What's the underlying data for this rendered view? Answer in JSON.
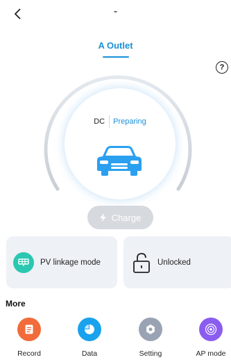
{
  "header": {
    "title": "-"
  },
  "tab": {
    "label": "A Outlet"
  },
  "status": {
    "type": "DC",
    "state": "Preparing"
  },
  "charge": {
    "label": "Charge"
  },
  "cards": {
    "pv_label": "PV linkage mode",
    "lock_label": "Unlocked"
  },
  "more": {
    "title": "More",
    "items": [
      {
        "label": "Record",
        "icon": "record-icon",
        "color": "#f26b3a"
      },
      {
        "label": "Data",
        "icon": "data-icon",
        "color": "#1aa2ec"
      },
      {
        "label": "Setting",
        "icon": "gear-icon",
        "color": "#9aa3b3"
      },
      {
        "label": "AP mode",
        "icon": "ap-mode-icon",
        "color": "#8a5df0"
      }
    ]
  },
  "colors": {
    "accent": "#1a90d8",
    "car": "#2b9ff0",
    "pv": "#2bc7b0"
  }
}
